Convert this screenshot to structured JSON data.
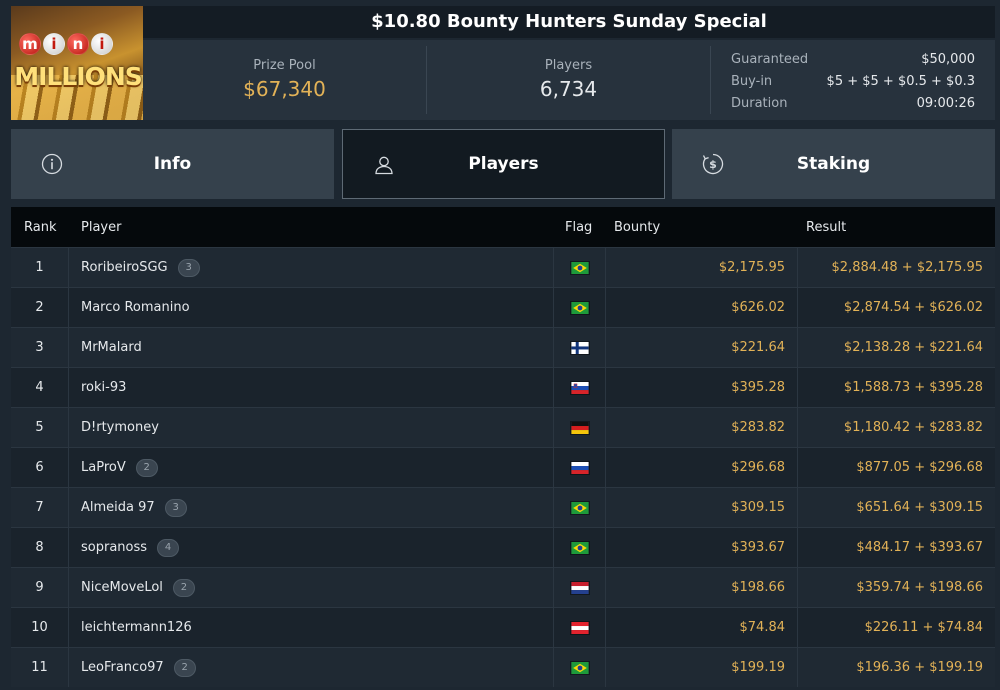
{
  "logo": {
    "mini_letters": [
      "m",
      "i",
      "n",
      "i"
    ],
    "word": "MILLIONS"
  },
  "header": {
    "title": "$10.80 Bounty Hunters Sunday Special",
    "prize_pool_label": "Prize Pool",
    "prize_pool_value": "$67,340",
    "players_label": "Players",
    "players_value": "6,734",
    "details": [
      {
        "label": "Guaranteed",
        "value": "$50,000"
      },
      {
        "label": "Buy-in",
        "value": "$5 + $5 + $0.5 + $0.3"
      },
      {
        "label": "Duration",
        "value": "09:00:26"
      }
    ]
  },
  "tabs": [
    {
      "label": "Info",
      "icon": "info-icon",
      "active": false
    },
    {
      "label": "Players",
      "icon": "user-icon",
      "active": true
    },
    {
      "label": "Staking",
      "icon": "staking-icon",
      "active": false
    }
  ],
  "table": {
    "columns": [
      "Rank",
      "Player",
      "Flag",
      "Bounty",
      "Result"
    ],
    "rows": [
      {
        "rank": "1",
        "player": "RoribeiroSGG",
        "badge": "3",
        "flag": "brazil",
        "bounty": "$2,175.95",
        "result": "$2,884.48 + $2,175.95"
      },
      {
        "rank": "2",
        "player": "Marco Romanino",
        "badge": "",
        "flag": "brazil",
        "bounty": "$626.02",
        "result": "$2,874.54 + $626.02"
      },
      {
        "rank": "3",
        "player": "MrMalard",
        "badge": "",
        "flag": "finland",
        "bounty": "$221.64",
        "result": "$2,138.28 + $221.64"
      },
      {
        "rank": "4",
        "player": "roki-93",
        "badge": "",
        "flag": "slovenia",
        "bounty": "$395.28",
        "result": "$1,588.73 + $395.28"
      },
      {
        "rank": "5",
        "player": "D!rtymoney",
        "badge": "",
        "flag": "germany",
        "bounty": "$283.82",
        "result": "$1,180.42 + $283.82"
      },
      {
        "rank": "6",
        "player": "LaProV",
        "badge": "2",
        "flag": "russia",
        "bounty": "$296.68",
        "result": "$877.05 + $296.68"
      },
      {
        "rank": "7",
        "player": "Almeida 97",
        "badge": "3",
        "flag": "brazil",
        "bounty": "$309.15",
        "result": "$651.64 + $309.15"
      },
      {
        "rank": "8",
        "player": "sopranoss",
        "badge": "4",
        "flag": "brazil",
        "bounty": "$393.67",
        "result": "$484.17 + $393.67"
      },
      {
        "rank": "9",
        "player": "NiceMoveLol",
        "badge": "2",
        "flag": "netherlands",
        "bounty": "$198.66",
        "result": "$359.74 + $198.66"
      },
      {
        "rank": "10",
        "player": "leichtermann126",
        "badge": "",
        "flag": "austria",
        "bounty": "$74.84",
        "result": "$226.11 + $74.84"
      },
      {
        "rank": "11",
        "player": "LeoFranco97",
        "badge": "2",
        "flag": "brazil",
        "bounty": "$199.19",
        "result": "$196.36 + $199.19"
      }
    ]
  },
  "colors": {
    "accent_gold": "#e2b257",
    "background": "#1d2731",
    "title_bar": "#141c24",
    "active_tab": "#121a21"
  }
}
